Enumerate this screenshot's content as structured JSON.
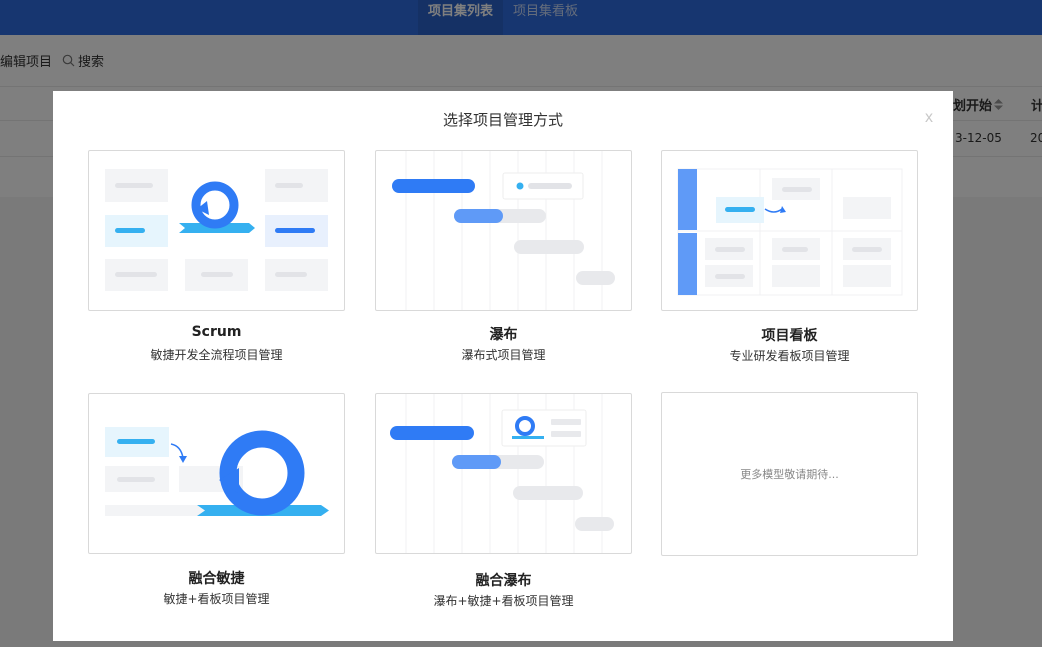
{
  "topbar": {
    "tabs": [
      {
        "label": "项目集列表",
        "active": true
      },
      {
        "label": "项目集看板",
        "active": false
      }
    ]
  },
  "toolbar": {
    "edit_label": "编辑项目",
    "search_label": "搜索"
  },
  "table": {
    "headers": [
      "划开始",
      "计"
    ],
    "row": [
      "3-12-05",
      "20"
    ]
  },
  "modal": {
    "title": "选择项目管理方式",
    "close_label": "x",
    "cards": [
      {
        "name": "Scrum",
        "desc": "敏捷开发全流程项目管理"
      },
      {
        "name": "瀑布",
        "desc": "瀑布式项目管理"
      },
      {
        "name": "项目看板",
        "desc": "专业研发看板项目管理"
      },
      {
        "name": "融合敏捷",
        "desc": "敏捷+看板项目管理"
      },
      {
        "name": "融合瀑布",
        "desc": "瀑布+敏捷+看板项目管理"
      }
    ],
    "more_text": "更多模型敬请期待..."
  },
  "colors": {
    "primary": "#2f7bf5",
    "accent": "#35b0f0",
    "light_block": "#f3f4f6",
    "gray_bar": "#e8e9ec"
  }
}
